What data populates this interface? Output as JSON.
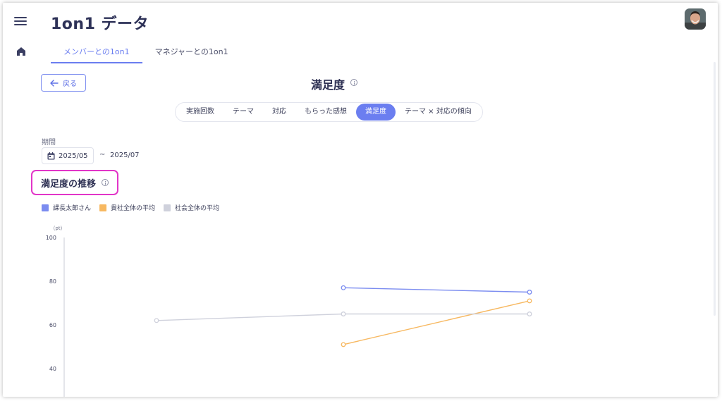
{
  "header": {
    "title": "1on1 データ",
    "tabs": [
      {
        "label": "メンバーとの1on1",
        "active": true
      },
      {
        "label": "マネジャーとの1on1",
        "active": false
      }
    ]
  },
  "icons": {
    "menu": "hamburger-menu-icon",
    "home": "home-icon",
    "back": "arrow-left-icon",
    "info": "info-icon",
    "calendar": "calendar-icon"
  },
  "back_label": "戻る",
  "page_title": "満足度",
  "segments": [
    {
      "label": "実施回数",
      "active": false
    },
    {
      "label": "テーマ",
      "active": false
    },
    {
      "label": "対応",
      "active": false
    },
    {
      "label": "もらった感想",
      "active": false
    },
    {
      "label": "満足度",
      "active": true
    },
    {
      "label": "テーマ × 対応の傾向",
      "active": false
    }
  ],
  "period": {
    "label": "期間",
    "from": "2025/05",
    "separator": "~",
    "to": "2025/07"
  },
  "section_title": "満足度の推移",
  "colors": {
    "accent": "#6b7ef0",
    "highlight_border": "#e235c8",
    "series_self": "#7b8cf0",
    "series_company": "#f7b860",
    "series_society": "#cfd1dc"
  },
  "legend": [
    {
      "label": "課長太郎さん",
      "color": "#7b8cf0"
    },
    {
      "label": "貴社全体の平均",
      "color": "#f7b860"
    },
    {
      "label": "社会全体の平均",
      "color": "#cfd1dc"
    }
  ],
  "chart_data": {
    "type": "line",
    "unit_label": "（pt）",
    "yticks": [
      40,
      60,
      80,
      100
    ],
    "ylim": [
      28,
      100
    ],
    "x": [
      1,
      2,
      3
    ],
    "series": [
      {
        "name": "課長太郎さん",
        "color": "#7b8cf0",
        "values": [
          null,
          77,
          75
        ]
      },
      {
        "name": "貴社全体の平均",
        "color": "#f7b860",
        "values": [
          null,
          51,
          71
        ]
      },
      {
        "name": "社会全体の平均",
        "color": "#cfd1dc",
        "values": [
          62,
          65,
          65
        ]
      }
    ],
    "grid": false
  }
}
